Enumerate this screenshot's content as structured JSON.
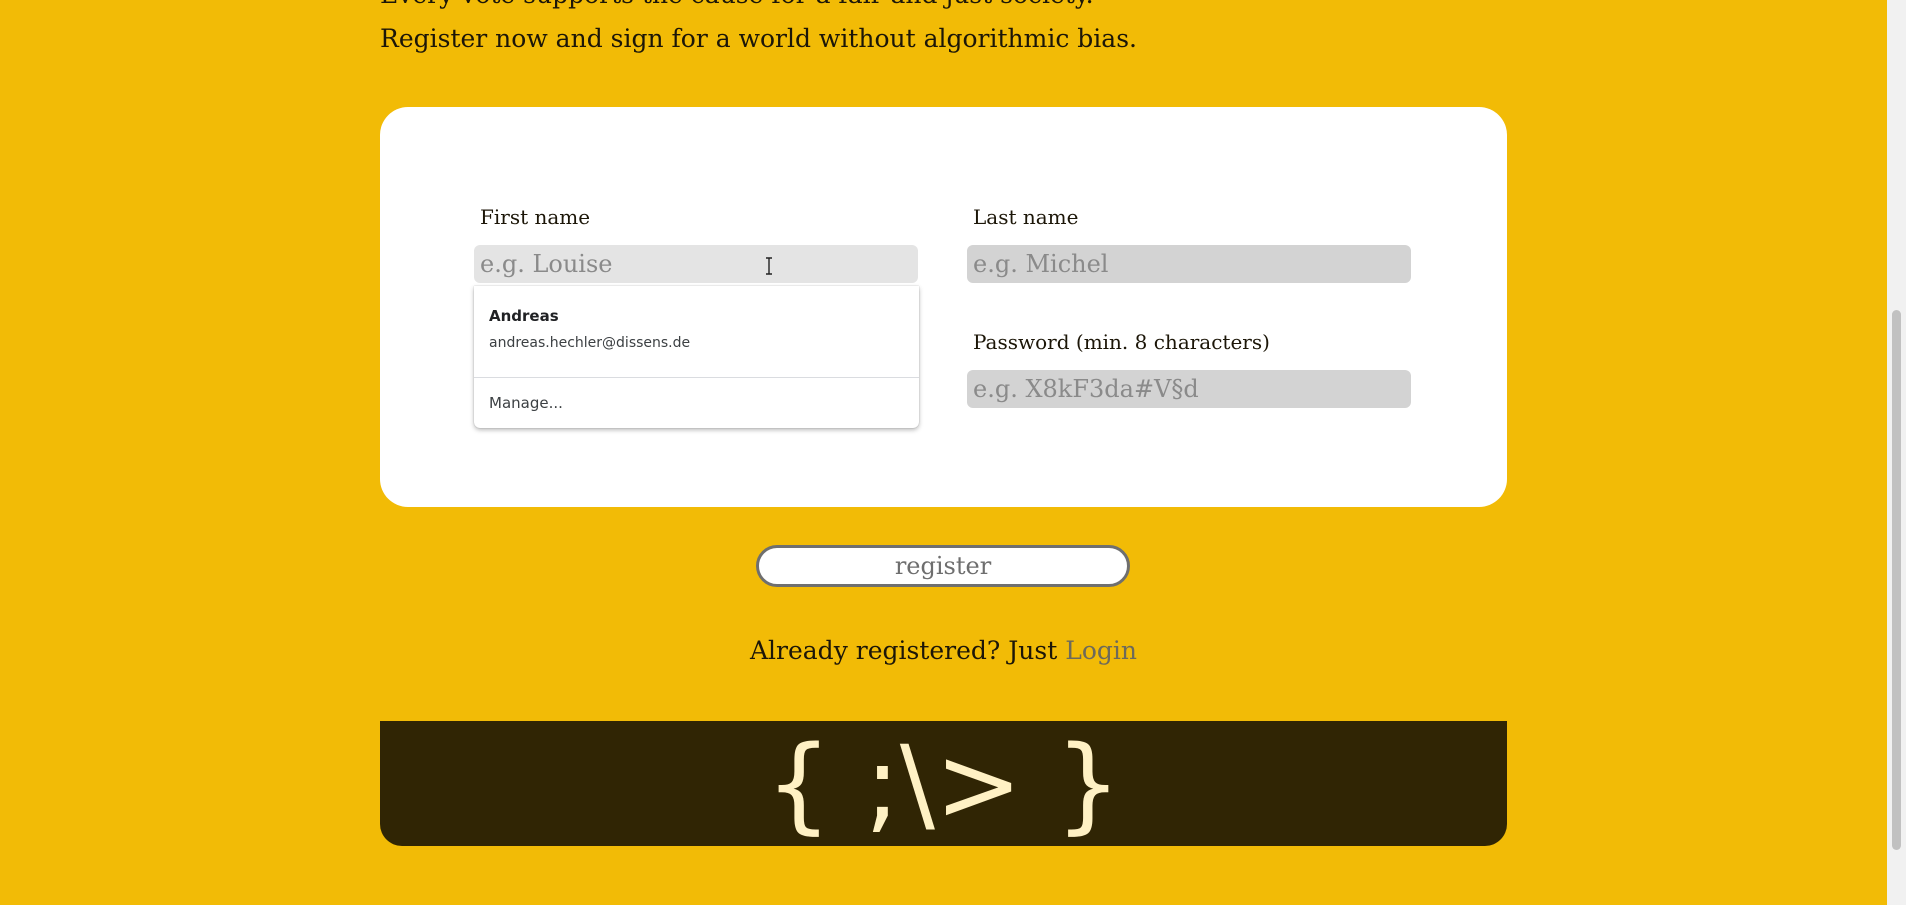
{
  "intro": {
    "line1": "Every vote supports the cause for a fair and just society.",
    "line2": "Register now and sign for a world without algorithmic bias."
  },
  "form": {
    "first_name": {
      "label": "First name",
      "placeholder": "e.g. Louise",
      "value": ""
    },
    "last_name": {
      "label": "Last name",
      "placeholder": "e.g. Michel",
      "value": ""
    },
    "password": {
      "label": "Password (min. 8 characters)",
      "placeholder": "e.g. X8kF3da#V§d",
      "value": ""
    }
  },
  "autocomplete": {
    "suggestion_name": "Andreas",
    "suggestion_email": "andreas.hechler@dissens.de",
    "manage_label": "Manage..."
  },
  "register_button": {
    "label": "register"
  },
  "login": {
    "prompt": "Already registered? Just",
    "link_label": "Login"
  },
  "footer": {
    "logo_text": "{ ;\\> }"
  },
  "colors": {
    "page_background": "#f2bb06",
    "card_background": "#ffffff",
    "input_background": "#d3d3d3",
    "footer_background": "#302504",
    "footer_logo": "#fff1c4"
  }
}
